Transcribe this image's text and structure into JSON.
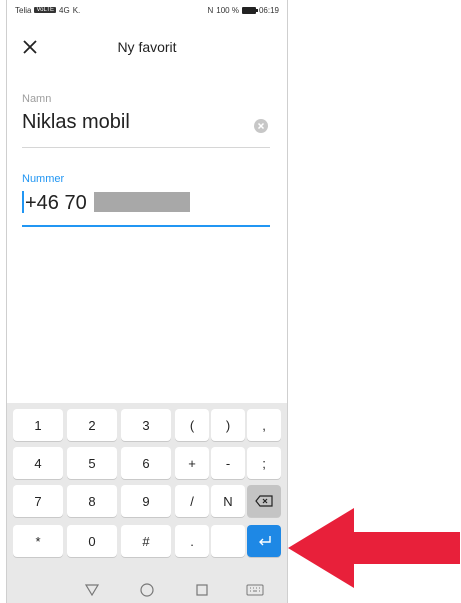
{
  "status_bar": {
    "carrier": "Telia",
    "network_badge": "VoLTE",
    "signal": "4G",
    "extra": "K.",
    "nfc": "N",
    "battery": "100 %",
    "time": "06:19"
  },
  "header": {
    "title": "Ny favorit",
    "close_icon": "close-icon"
  },
  "form": {
    "name": {
      "label": "Namn",
      "value": "Niklas mobil",
      "clear_icon": "clear-circle-icon"
    },
    "number": {
      "label": "Nummer",
      "value": "+46 70"
    }
  },
  "keyboard": {
    "rows": [
      [
        "1",
        "2",
        "3",
        "(",
        ")",
        ","
      ],
      [
        "4",
        "5",
        "6",
        "+",
        "-",
        ";"
      ],
      [
        "7",
        "8",
        "9",
        "/",
        "N",
        "backspace-icon"
      ],
      [
        "*",
        "0",
        "#",
        ".",
        "",
        "enter-icon"
      ]
    ]
  },
  "nav_bar": {
    "icons": [
      "back-triangle-icon",
      "home-circle-icon",
      "recents-square-icon",
      "keyboard-icon"
    ]
  },
  "annotation": {
    "arrow": "red-arrow-icon"
  },
  "colors": {
    "accent": "#2196f3",
    "label_grey": "#9e9e9e",
    "enter_key": "#1e88e5",
    "arrow": "#e8203a",
    "keyboard_bg": "#e8e8e8"
  }
}
